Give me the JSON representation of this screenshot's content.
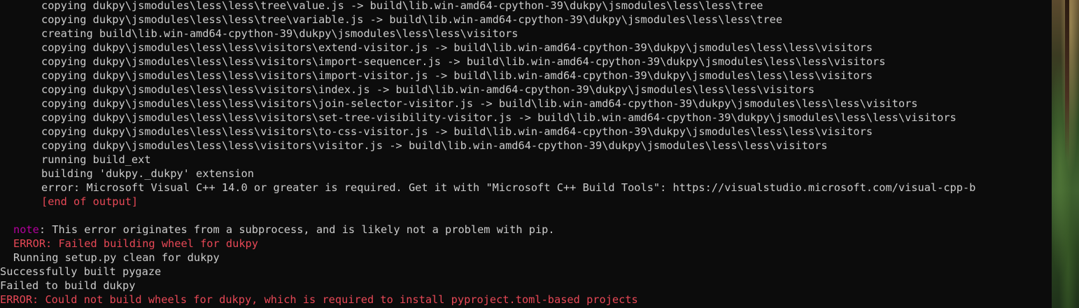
{
  "terminal": {
    "lines": [
      {
        "indent": 2,
        "text": "copying dukpy\\jsmodules\\less\\less\\tree\\value.js -> build\\lib.win-amd64-cpython-39\\dukpy\\jsmodules\\less\\less\\tree"
      },
      {
        "indent": 2,
        "text": "copying dukpy\\jsmodules\\less\\less\\tree\\variable.js -> build\\lib.win-amd64-cpython-39\\dukpy\\jsmodules\\less\\less\\tree"
      },
      {
        "indent": 2,
        "text": "creating build\\lib.win-amd64-cpython-39\\dukpy\\jsmodules\\less\\less\\visitors"
      },
      {
        "indent": 2,
        "text": "copying dukpy\\jsmodules\\less\\less\\visitors\\extend-visitor.js -> build\\lib.win-amd64-cpython-39\\dukpy\\jsmodules\\less\\less\\visitors"
      },
      {
        "indent": 2,
        "text": "copying dukpy\\jsmodules\\less\\less\\visitors\\import-sequencer.js -> build\\lib.win-amd64-cpython-39\\dukpy\\jsmodules\\less\\less\\visitors"
      },
      {
        "indent": 2,
        "text": "copying dukpy\\jsmodules\\less\\less\\visitors\\import-visitor.js -> build\\lib.win-amd64-cpython-39\\dukpy\\jsmodules\\less\\less\\visitors"
      },
      {
        "indent": 2,
        "text": "copying dukpy\\jsmodules\\less\\less\\visitors\\index.js -> build\\lib.win-amd64-cpython-39\\dukpy\\jsmodules\\less\\less\\visitors"
      },
      {
        "indent": 2,
        "text": "copying dukpy\\jsmodules\\less\\less\\visitors\\join-selector-visitor.js -> build\\lib.win-amd64-cpython-39\\dukpy\\jsmodules\\less\\less\\visitors"
      },
      {
        "indent": 2,
        "text": "copying dukpy\\jsmodules\\less\\less\\visitors\\set-tree-visibility-visitor.js -> build\\lib.win-amd64-cpython-39\\dukpy\\jsmodules\\less\\less\\visitors"
      },
      {
        "indent": 2,
        "text": "copying dukpy\\jsmodules\\less\\less\\visitors\\to-css-visitor.js -> build\\lib.win-amd64-cpython-39\\dukpy\\jsmodules\\less\\less\\visitors"
      },
      {
        "indent": 2,
        "text": "copying dukpy\\jsmodules\\less\\less\\visitors\\visitor.js -> build\\lib.win-amd64-cpython-39\\dukpy\\jsmodules\\less\\less\\visitors"
      },
      {
        "indent": 2,
        "text": "running build_ext"
      },
      {
        "indent": 2,
        "text": "building 'dukpy._dukpy' extension"
      },
      {
        "indent": 2,
        "text": "error: Microsoft Visual C++ 14.0 or greater is required. Get it with \"Microsoft C++ Build Tools\": https://visualstudio.microsoft.com/visual-cpp-b"
      },
      {
        "indent": 2,
        "text": "[end of output]",
        "color": "red"
      },
      {
        "indent": 0,
        "text": ""
      },
      {
        "indent": 1,
        "prefix": "note",
        "prefix_color": "purple",
        "text": ": This error originates from a subprocess, and is likely not a problem with pip."
      },
      {
        "indent": 1,
        "text": "ERROR: Failed building wheel for dukpy",
        "color": "red"
      },
      {
        "indent": 1,
        "text": "Running setup.py clean for dukpy"
      },
      {
        "indent": 0,
        "text": "Successfully built pygaze"
      },
      {
        "indent": 0,
        "text": "Failed to build dukpy"
      },
      {
        "indent": 0,
        "text": "ERROR: Could not build wheels for dukpy, which is required to install pyproject.toml-based projects",
        "color": "red"
      }
    ]
  },
  "colors": {
    "background": "#0c0c0c",
    "foreground": "#cccccc",
    "red": "#e74856",
    "purple": "#b4009e"
  }
}
